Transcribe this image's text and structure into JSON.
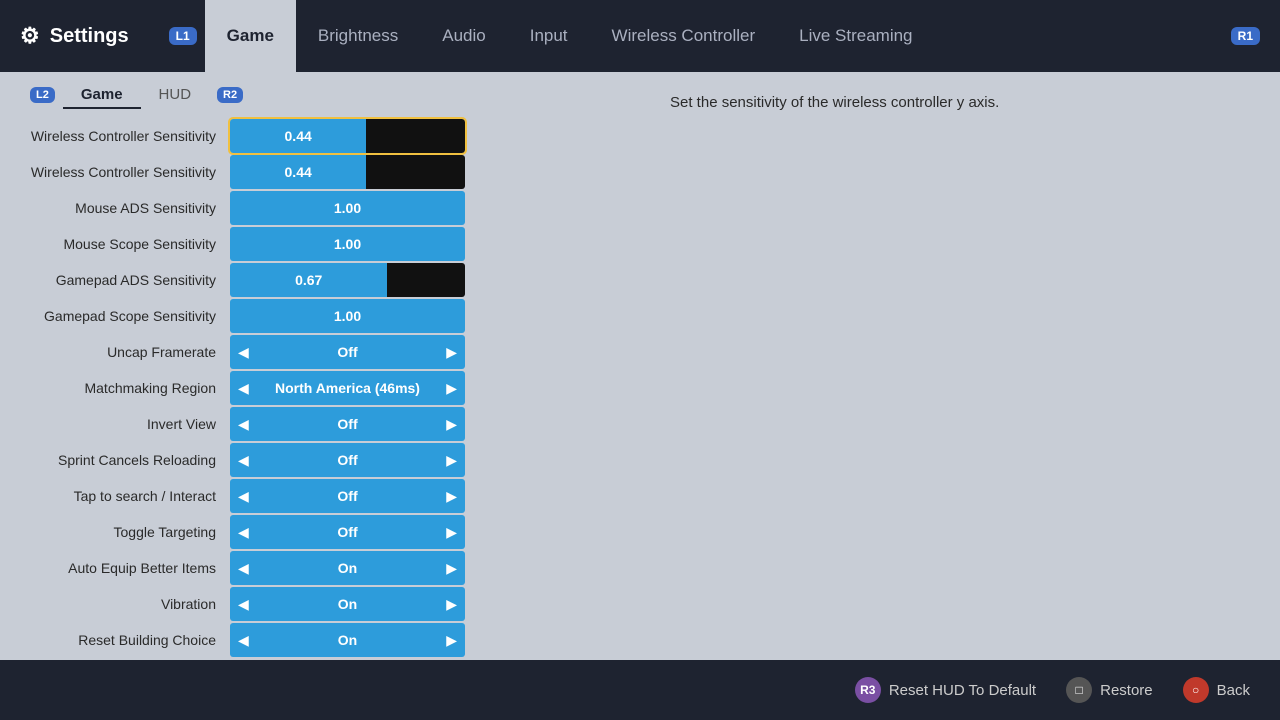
{
  "app": {
    "title": "Settings",
    "gear_symbol": "⚙"
  },
  "topnav": {
    "l1_label": "L1",
    "r1_label": "R1",
    "tabs": [
      {
        "id": "game",
        "label": "Game",
        "active": true
      },
      {
        "id": "brightness",
        "label": "Brightness",
        "active": false
      },
      {
        "id": "audio",
        "label": "Audio",
        "active": false
      },
      {
        "id": "input",
        "label": "Input",
        "active": false
      },
      {
        "id": "wireless",
        "label": "Wireless Controller",
        "active": false
      },
      {
        "id": "streaming",
        "label": "Live Streaming",
        "active": false
      }
    ]
  },
  "subtabs": {
    "l2_label": "L2",
    "r2_label": "R2",
    "tabs": [
      {
        "id": "game",
        "label": "Game",
        "active": true
      },
      {
        "id": "hud",
        "label": "HUD",
        "active": false
      }
    ]
  },
  "description": "Set the sensitivity of the wireless controller y axis.",
  "settings": [
    {
      "label": "Wireless Controller Sensitivity",
      "type": "slider",
      "value": "0.44",
      "fill_pct": 58,
      "focused": true
    },
    {
      "label": "Wireless Controller Sensitivity",
      "type": "slider",
      "value": "0.44",
      "fill_pct": 58,
      "focused": false
    },
    {
      "label": "Mouse ADS Sensitivity",
      "type": "slider",
      "value": "1.00",
      "fill_pct": 100,
      "focused": false
    },
    {
      "label": "Mouse Scope Sensitivity",
      "type": "slider",
      "value": "1.00",
      "fill_pct": 100,
      "focused": false
    },
    {
      "label": "Gamepad ADS Sensitivity",
      "type": "slider",
      "value": "0.67",
      "fill_pct": 67,
      "focused": false
    },
    {
      "label": "Gamepad Scope Sensitivity",
      "type": "slider",
      "value": "1.00",
      "fill_pct": 100,
      "focused": false
    },
    {
      "label": "Uncap Framerate",
      "type": "selector",
      "value": "Off"
    },
    {
      "label": "Matchmaking Region",
      "type": "selector",
      "value": "North America (46ms)"
    },
    {
      "label": "Invert View",
      "type": "selector",
      "value": "Off"
    },
    {
      "label": "Sprint Cancels Reloading",
      "type": "selector",
      "value": "Off"
    },
    {
      "label": "Tap to search / Interact",
      "type": "selector",
      "value": "Off"
    },
    {
      "label": "Toggle Targeting",
      "type": "selector",
      "value": "Off"
    },
    {
      "label": "Auto Equip Better Items",
      "type": "selector",
      "value": "On"
    },
    {
      "label": "Vibration",
      "type": "selector",
      "value": "On"
    },
    {
      "label": "Reset Building Choice",
      "type": "selector",
      "value": "On"
    }
  ],
  "bottombar": {
    "reset_label": "Reset HUD To Default",
    "restore_label": "Restore",
    "back_label": "Back"
  }
}
